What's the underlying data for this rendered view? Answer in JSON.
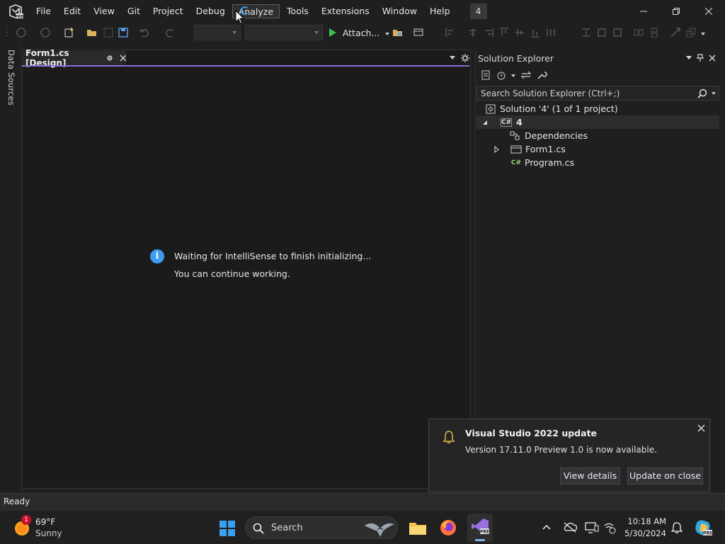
{
  "menubar": {
    "items": [
      "File",
      "Edit",
      "View",
      "Git",
      "Project",
      "Debug",
      "Analyze",
      "Tools",
      "Extensions",
      "Window",
      "Help"
    ],
    "active_index": 6,
    "solution_badge": "4"
  },
  "toolbar": {
    "attach_label": "Attach..."
  },
  "left_strip": {
    "data_sources_label": "Data Sources"
  },
  "document": {
    "tab_label": "Form1.cs [Design]",
    "info_line1": "Waiting for IntelliSense to finish initializing...",
    "info_line2": "You can continue working."
  },
  "solution_explorer": {
    "title": "Solution Explorer",
    "search_placeholder": "Search Solution Explorer (Ctrl+;)",
    "solution_label": "Solution '4' (1 of 1 project)",
    "project_label": "4",
    "items": [
      "Dependencies",
      "Form1.cs",
      "Program.cs"
    ]
  },
  "notification": {
    "title": "Visual Studio 2022 update",
    "message": "Version 17.11.0 Preview 1.0 is now available.",
    "view_details": "View details",
    "update_on_close": "Update on close"
  },
  "status": {
    "text": "Ready"
  },
  "taskbar": {
    "weather_temp": "69°F",
    "weather_desc": "Sunny",
    "weather_badge": "1",
    "search_label": "Search",
    "time": "10:18 AM",
    "date": "5/30/2024"
  },
  "colors": {
    "accent_purple": "#8a6cd6",
    "info_blue": "#3b9cf0",
    "run_green": "#3fbf4f"
  }
}
